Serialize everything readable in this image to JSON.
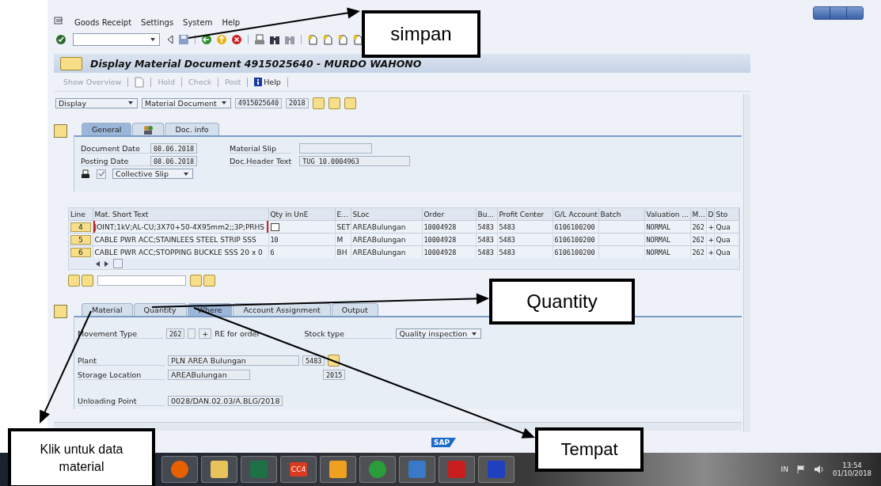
{
  "menu": [
    {
      "label": "Goods Receipt"
    },
    {
      "label": "Settings"
    },
    {
      "label": "System"
    },
    {
      "label": "Help"
    }
  ],
  "title": "Display Material Document 4915025640 - MURDO WAHONO",
  "app_toolbar": [
    {
      "kind": "text",
      "label": "Show Overview",
      "disabled": true
    },
    {
      "kind": "icon",
      "disabled": true
    },
    {
      "kind": "text",
      "label": "Hold",
      "disabled": true
    },
    {
      "kind": "text",
      "label": "Check",
      "disabled": true
    },
    {
      "kind": "text",
      "label": "Post",
      "disabled": true
    },
    {
      "kind": "info",
      "label": "Help",
      "disabled": false
    }
  ],
  "selector": {
    "action": "Display",
    "object": "Material Document",
    "document_number": "4915025640",
    "year": "2018"
  },
  "header_tabs": [
    {
      "kind": "text",
      "label": "General",
      "selected": true
    },
    {
      "kind": "icon",
      "selected": false
    },
    {
      "kind": "text",
      "label": "Doc. info",
      "selected": false
    }
  ],
  "header": {
    "document_date": {
      "label": "Document Date",
      "value": "08.06.2018"
    },
    "posting_date": {
      "label": "Posting Date",
      "value": "08.06.2018"
    },
    "material_slip": {
      "label": "Material Slip"
    },
    "doc_header_text": {
      "label": "Doc.Header Text",
      "value": "TUG 10.0004963"
    },
    "print_checked": true,
    "print_version": "Collective Slip"
  },
  "items_table": {
    "columns": [
      "Line",
      "Mat. Short Text",
      "Qty in UnE",
      "E...",
      "SLoc",
      "Order",
      "Bu...",
      "Profit Center",
      "G/L Account",
      "Batch",
      "Valuation ...",
      "M...",
      "D",
      "Sto"
    ],
    "rows": [
      {
        "focused": true,
        "qty_popup": true,
        "cells": [
          "4",
          "JOINT;1kV;AL-CU;3X70+50-4X95mm2;;3P;PRHS",
          null,
          "SET",
          "AREABulungan",
          "10004928",
          "5483",
          "5483",
          "6106100200",
          null,
          "NORMAL",
          "262",
          "+",
          "Qua"
        ]
      },
      {
        "focused": false,
        "qty_popup": false,
        "cells": [
          "5",
          "CABLE PWR ACC;STAINLEES STEEL STRIP SSS",
          "10",
          "M",
          "AREABulungan",
          "10004928",
          "5483",
          "5483",
          "6106100200",
          null,
          "NORMAL",
          "262",
          "+",
          "Qua"
        ]
      },
      {
        "focused": false,
        "qty_popup": false,
        "cells": [
          "6",
          "CABLE PWR ACC;STOPPING BUCKLE SSS 20 x 0",
          "6",
          "BH",
          "AREABulungan",
          "10004928",
          "5483",
          "5483",
          "6106100200",
          null,
          "NORMAL",
          "262",
          "+",
          "Qua"
        ]
      }
    ]
  },
  "detail_tabs": [
    {
      "label": "Material",
      "selected": false
    },
    {
      "label": "Quantity",
      "selected": false
    },
    {
      "label": "Where",
      "selected": true
    },
    {
      "label": "Account Assignment",
      "selected": false
    },
    {
      "label": "Output",
      "selected": false
    }
  ],
  "detail": {
    "movement_type": {
      "label": "Movement Type",
      "code": "262",
      "indicator": "+",
      "text": "RE for order"
    },
    "stock_type": {
      "label": "Stock type",
      "value": "Quality inspection"
    },
    "plant": {
      "label": "Plant",
      "name": "PLN AREA Bulungan",
      "code": "5483"
    },
    "storage_location": {
      "label": "Storage Location",
      "name": "AREABulungan",
      "code": "2015"
    },
    "unloading_point": {
      "label": "Unloading Point",
      "value": "0028/DAN.02.03/A.BLG/2018"
    }
  },
  "status_bar": {
    "logo": "SAP"
  },
  "taskbar": {
    "apps": [
      {
        "kind": "browser"
      },
      {
        "kind": "folder"
      },
      {
        "kind": "spreadsheet"
      },
      {
        "kind": "badge",
        "label": "CC4"
      },
      {
        "kind": "mail"
      },
      {
        "kind": "chrome"
      },
      {
        "kind": "app"
      },
      {
        "kind": "pdf"
      },
      {
        "kind": "paint"
      }
    ],
    "tray": {
      "language": "IN",
      "time": "13:54",
      "date": "01/10/2018"
    }
  },
  "annotations": [
    {
      "text": "simpan"
    },
    {
      "text": "Quantity"
    },
    {
      "text": "Tempat"
    },
    {
      "text": "Klik untuk data material"
    }
  ]
}
